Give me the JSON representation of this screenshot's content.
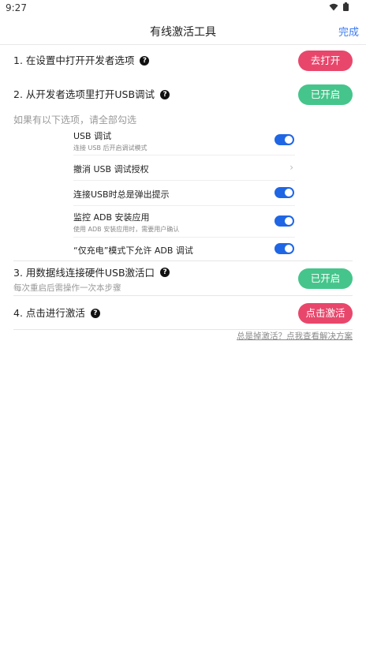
{
  "status": {
    "time": "9:27"
  },
  "nav": {
    "title": "有线激活工具",
    "done": "完成"
  },
  "steps": [
    {
      "label": "1. 在设置中打开开发者选项",
      "button": "去打开",
      "sub": ""
    },
    {
      "label": "2. 从开发者选项里打开USB调试",
      "button": "已开启",
      "sub": ""
    },
    {
      "label": "3. 用数据线连接硬件USB激活口",
      "button": "已开启",
      "sub": "每次重启后需操作一次本步骤"
    },
    {
      "label": "4. 点击进行激活",
      "button": "点击激活",
      "sub": ""
    }
  ],
  "hint": "如果有以下选项，请全部勾选",
  "options": [
    {
      "title": "USB 调试",
      "sub": "连接 USB 后开启调试模式",
      "control": "toggle",
      "on": true
    },
    {
      "title": "撤消 USB 调试授权",
      "sub": "",
      "control": "chevron"
    },
    {
      "title": "连接USB时总是弹出提示",
      "sub": "",
      "control": "toggle",
      "on": true
    },
    {
      "title": "监控 ADB 安装应用",
      "sub": "使用 ADB 安装应用时，需要用户确认",
      "control": "toggle",
      "on": true
    },
    {
      "title": "“仅充电”模式下允许 ADB 调试",
      "sub": "",
      "control": "toggle",
      "on": true
    }
  ],
  "help_link": "总是掉激活？点我查看解决方案",
  "colors": {
    "accent": "#3b7bf0",
    "red_button": "#e8476b",
    "green_button": "#45c58b",
    "toggle_on": "#1f66e5"
  },
  "icons": {
    "wifi": "wifi-icon",
    "battery": "battery-icon",
    "help": "help-icon",
    "chevron": "chevron-right-icon"
  }
}
